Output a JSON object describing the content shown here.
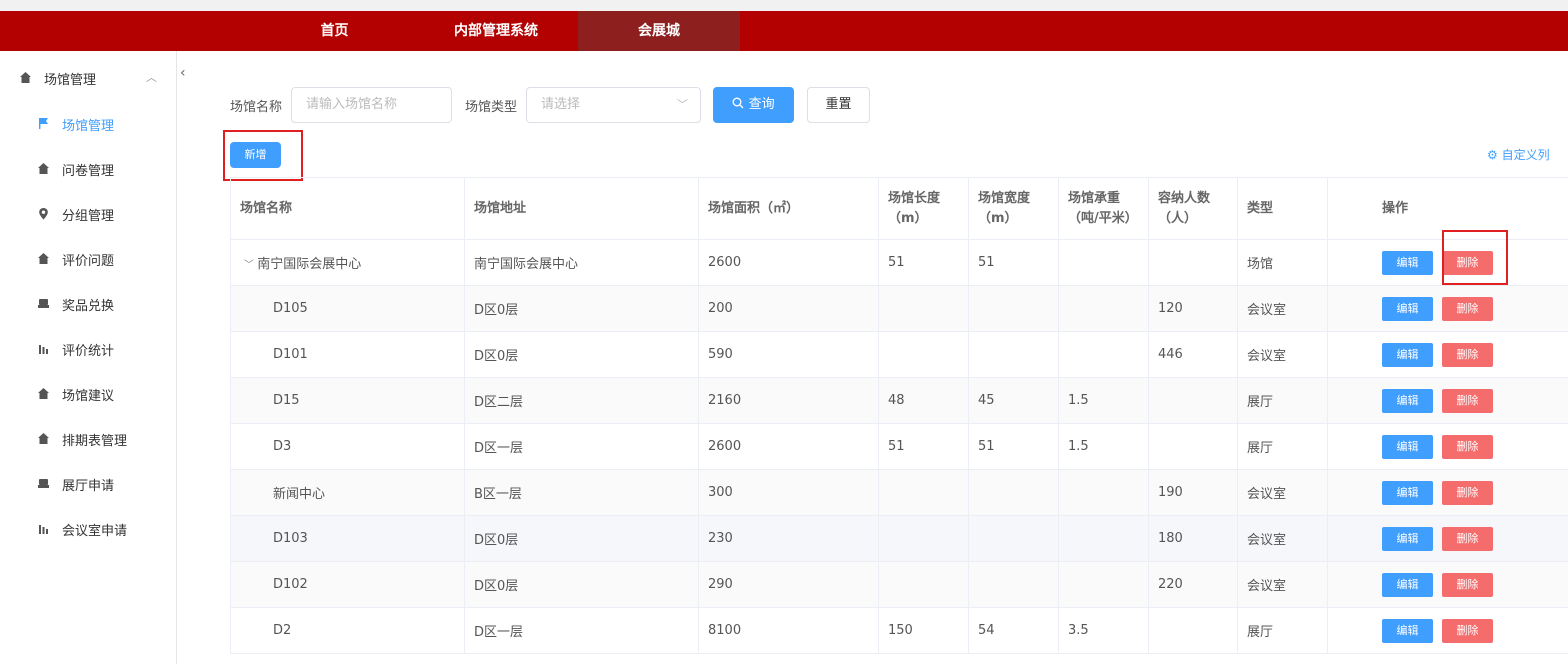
{
  "nav": {
    "items": [
      "首页",
      "内部管理系统",
      "会展城"
    ],
    "active_index": 2
  },
  "sidebar": {
    "group": {
      "label": "场馆管理",
      "icon": "home-icon"
    },
    "items": [
      {
        "label": "场馆管理",
        "icon": "flag-icon",
        "active": true
      },
      {
        "label": "问卷管理",
        "icon": "home-icon"
      },
      {
        "label": "分组管理",
        "icon": "location-icon"
      },
      {
        "label": "评价问题",
        "icon": "home-icon"
      },
      {
        "label": "奖品兑换",
        "icon": "printer-icon"
      },
      {
        "label": "评价统计",
        "icon": "bar-chart-icon"
      },
      {
        "label": "场馆建议",
        "icon": "home-icon"
      },
      {
        "label": "排期表管理",
        "icon": "home-icon"
      },
      {
        "label": "展厅申请",
        "icon": "printer-icon"
      },
      {
        "label": "会议室申请",
        "icon": "bar-chart-icon"
      }
    ]
  },
  "filters": {
    "name_label": "场馆名称",
    "name_placeholder": "请输入场馆名称",
    "type_label": "场馆类型",
    "type_placeholder": "请选择",
    "query_label": "查询",
    "reset_label": "重置"
  },
  "toolbar": {
    "add_label": "新增",
    "customize_label": "自定义列"
  },
  "table": {
    "headers": [
      "场馆名称",
      "场馆地址",
      "场馆面积（㎡）",
      "场馆长度（m）",
      "场馆宽度（m）",
      "场馆承重（吨/平米）",
      "容纳人数（人）",
      "类型",
      "操作"
    ],
    "edit_label": "编辑",
    "delete_label": "删除",
    "rows": [
      {
        "name": "南宁国际会展中心",
        "address": "南宁国际会展中心",
        "area": "2600",
        "length": "51",
        "width": "51",
        "load": "",
        "capacity": "",
        "type": "场馆",
        "parent": true
      },
      {
        "name": "D105",
        "address": "D区0层",
        "area": "200",
        "length": "",
        "width": "",
        "load": "",
        "capacity": "120",
        "type": "会议室"
      },
      {
        "name": "D101",
        "address": "D区0层",
        "area": "590",
        "length": "",
        "width": "",
        "load": "",
        "capacity": "446",
        "type": "会议室"
      },
      {
        "name": "D15",
        "address": "D区二层",
        "area": "2160",
        "length": "48",
        "width": "45",
        "load": "1.5",
        "capacity": "",
        "type": "展厅"
      },
      {
        "name": "D3",
        "address": "D区一层",
        "area": "2600",
        "length": "51",
        "width": "51",
        "load": "1.5",
        "capacity": "",
        "type": "展厅"
      },
      {
        "name": "新闻中心",
        "address": "B区一层",
        "area": "300",
        "length": "",
        "width": "",
        "load": "",
        "capacity": "190",
        "type": "会议室"
      },
      {
        "name": "D103",
        "address": "D区0层",
        "area": "230",
        "length": "",
        "width": "",
        "load": "",
        "capacity": "180",
        "type": "会议室"
      },
      {
        "name": "D102",
        "address": "D区0层",
        "area": "290",
        "length": "",
        "width": "",
        "load": "",
        "capacity": "220",
        "type": "会议室"
      },
      {
        "name": "D2",
        "address": "D区一层",
        "area": "8100",
        "length": "150",
        "width": "54",
        "load": "3.5",
        "capacity": "",
        "type": "展厅"
      }
    ]
  }
}
